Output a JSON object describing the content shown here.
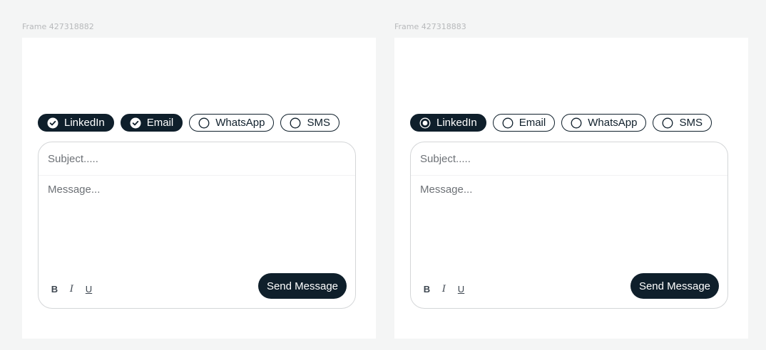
{
  "colors": {
    "accent": "#0f1f2b",
    "canvas": "#f4f5f5",
    "frame": "#ffffff",
    "border": "#d4d6d8"
  },
  "frames": [
    {
      "label": "Frame 427318882",
      "selection_mode": "multi-check",
      "channels": [
        {
          "label": "LinkedIn",
          "selected": true,
          "icon": "check-circle-icon"
        },
        {
          "label": "Email",
          "selected": true,
          "icon": "check-circle-icon"
        },
        {
          "label": "WhatsApp",
          "selected": false,
          "icon": "radio-empty-icon"
        },
        {
          "label": "SMS",
          "selected": false,
          "icon": "radio-empty-icon"
        }
      ],
      "subject_placeholder": "Subject.....",
      "message_placeholder": "Message...",
      "format": {
        "bold": "B",
        "italic": "I",
        "underline": "U"
      },
      "send_label": "Send Message"
    },
    {
      "label": "Frame 427318883",
      "selection_mode": "single-radio",
      "channels": [
        {
          "label": "LinkedIn",
          "selected": true,
          "icon": "radio-selected-icon"
        },
        {
          "label": "Email",
          "selected": false,
          "icon": "radio-empty-icon"
        },
        {
          "label": "WhatsApp",
          "selected": false,
          "icon": "radio-empty-icon"
        },
        {
          "label": "SMS",
          "selected": false,
          "icon": "radio-empty-icon"
        }
      ],
      "subject_placeholder": "Subject.....",
      "message_placeholder": "Message...",
      "format": {
        "bold": "B",
        "italic": "I",
        "underline": "U"
      },
      "send_label": "Send Message"
    }
  ]
}
